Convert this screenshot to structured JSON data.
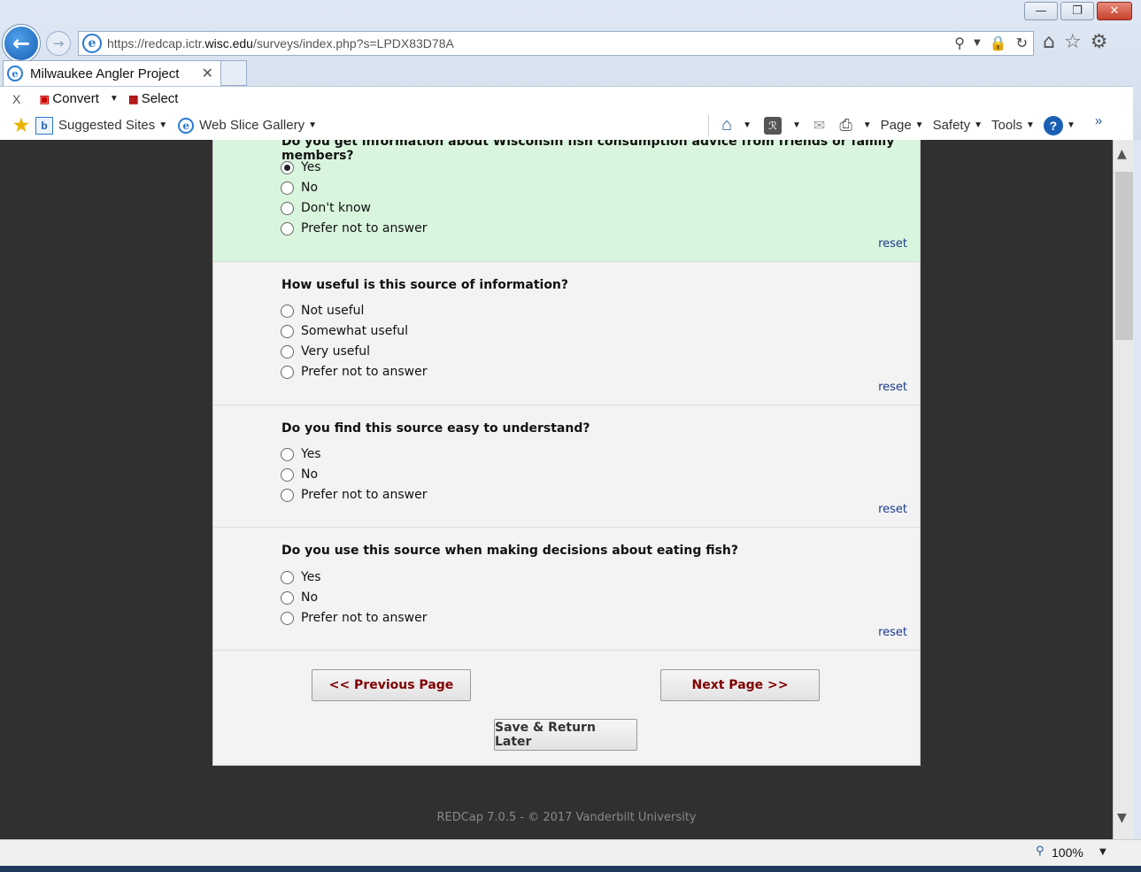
{
  "window": {
    "minimize": "—",
    "restore": "❐",
    "close": "✕"
  },
  "address": {
    "prefix": "https://redcap.ictr.",
    "domain": "wisc.edu",
    "suffix": "/surveys/index.php?s=LPDX83D78A"
  },
  "tab": {
    "title": "Milwaukee Angler Project",
    "close": "✕"
  },
  "commandbar": {
    "close": "X",
    "convert": "Convert",
    "select": "Select"
  },
  "favorites": {
    "suggested": "Suggested Sites",
    "webslice": "Web Slice Gallery",
    "page": "Page",
    "safety": "Safety",
    "tools": "Tools",
    "overflow": "»"
  },
  "survey": {
    "q1": {
      "title": "Do you get information about Wisconsin fish consumption advice from friends or family members?",
      "options": [
        "Yes",
        "No",
        "Don't know",
        "Prefer not to answer"
      ],
      "selected": 0,
      "reset": "reset"
    },
    "q2": {
      "title": "How useful is this source of information?",
      "options": [
        "Not useful",
        "Somewhat useful",
        "Very useful",
        "Prefer not to answer"
      ],
      "reset": "reset"
    },
    "q3": {
      "title": "Do you find this source easy to understand?",
      "options": [
        "Yes",
        "No",
        "Prefer not to answer"
      ],
      "reset": "reset"
    },
    "q4": {
      "title": "Do you use this source when making decisions about eating fish?",
      "options": [
        "Yes",
        "No",
        "Prefer not to answer"
      ],
      "reset": "reset"
    },
    "prev_label": "<< Previous Page",
    "next_label": "Next Page >>",
    "save_label": "Save & Return Later"
  },
  "footer": "REDCap 7.0.5 - © 2017 Vanderbilt University",
  "status": {
    "zoom": "100%"
  }
}
